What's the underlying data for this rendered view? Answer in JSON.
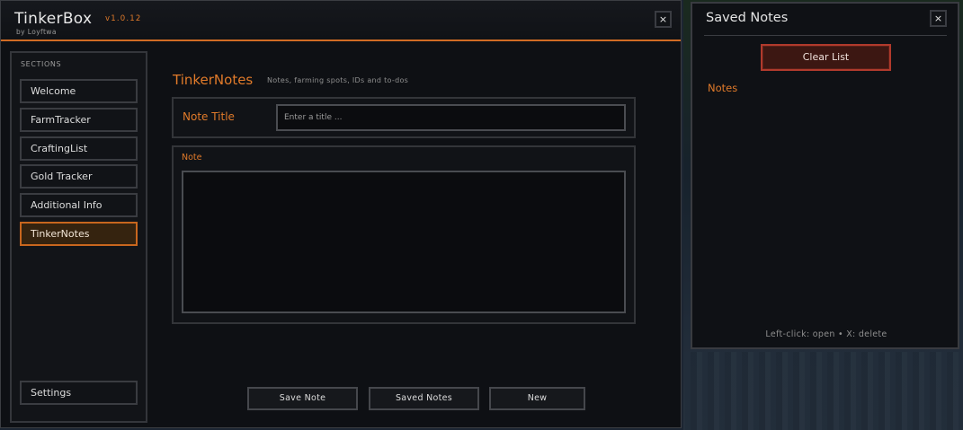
{
  "app": {
    "title": "TinkerBox",
    "version": "v1.0.12",
    "author": "by Loyftwa",
    "close_label": "×"
  },
  "sidebar": {
    "heading": "SECTIONS",
    "items": [
      {
        "label": "Welcome",
        "active": false
      },
      {
        "label": "FarmTracker",
        "active": false
      },
      {
        "label": "CraftingList",
        "active": false
      },
      {
        "label": "Gold Tracker",
        "active": false
      },
      {
        "label": "Additional Info",
        "active": false
      },
      {
        "label": "TinkerNotes",
        "active": true
      }
    ],
    "settings_label": "Settings"
  },
  "content": {
    "title": "TinkerNotes",
    "subtitle": "Notes, farming spots, IDs and to-dos",
    "note_title_label": "Note Title",
    "note_title_placeholder": "Enter a title ...",
    "note_title_value": "",
    "note_label": "Note",
    "note_value": ""
  },
  "actions": {
    "save_label": "Save Note",
    "saved_notes_label": "Saved Notes",
    "new_label": "New"
  },
  "saved_panel": {
    "title": "Saved Notes",
    "close_label": "×",
    "clear_label": "Clear List",
    "list_heading": "Notes",
    "hint": "Left-click: open  •  X: delete"
  },
  "colors": {
    "accent": "#e07a2a",
    "active_bg": "#35230f",
    "danger_border": "#b03a2c",
    "danger_bg": "#3c1712"
  }
}
